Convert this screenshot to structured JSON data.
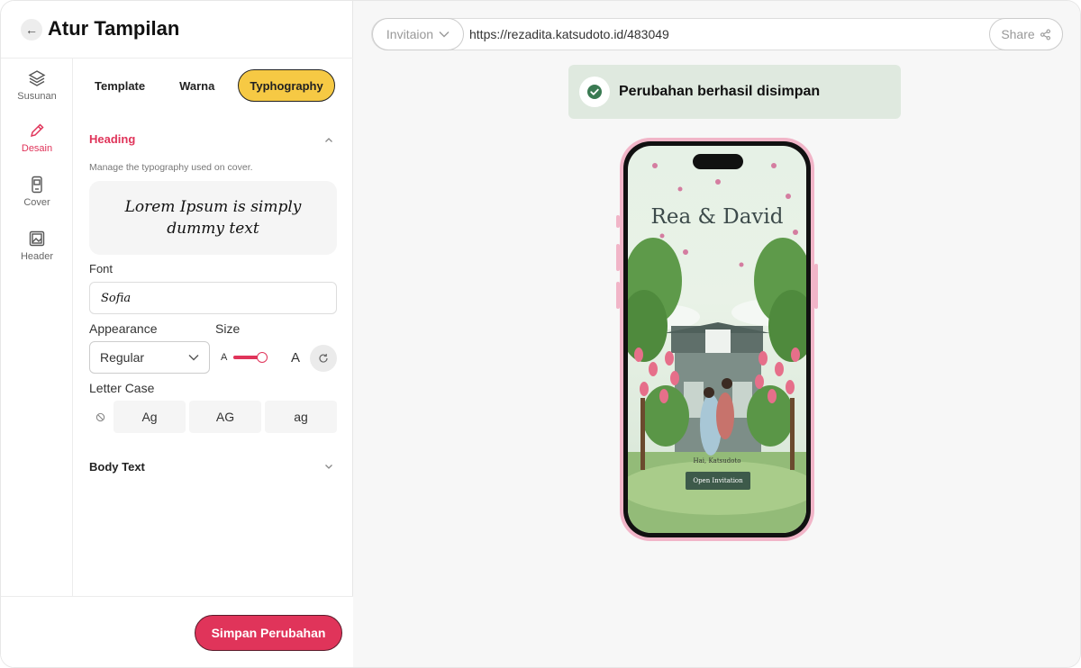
{
  "header": {
    "title": "Atur Tampilan"
  },
  "rail": [
    {
      "label": "Susunan",
      "icon": "layers-icon",
      "active": false
    },
    {
      "label": "Desain",
      "icon": "pen-icon",
      "active": true
    },
    {
      "label": "Cover",
      "icon": "phone-cover-icon",
      "active": false
    },
    {
      "label": "Header",
      "icon": "image-icon",
      "active": false
    }
  ],
  "tabs": [
    "Template",
    "Warna",
    "Typhography"
  ],
  "active_tab": "Typhography",
  "heading": {
    "title": "Heading",
    "description": "Manage the typography used on cover.",
    "preview_text": "Lorem Ipsum is simply dummy text",
    "font_label": "Font",
    "font_value": "Sofia",
    "appearance_label": "Appearance",
    "appearance_value": "Regular",
    "size_label": "Size",
    "size_small": "A",
    "size_big": "A",
    "size_level": 0.85,
    "letter_case_label": "Letter Case",
    "letter_case_options": [
      "Ag",
      "AG",
      "ag"
    ]
  },
  "body_text": {
    "title": "Body Text"
  },
  "footer": {
    "save_label": "Simpan Perubahan"
  },
  "browser": {
    "select_label": "Invitaion",
    "url": "https://rezadita.katsudoto.id/483049",
    "share_label": "Share"
  },
  "toast": {
    "message": "Perubahan berhasil disimpan"
  },
  "phone": {
    "couple": "Rea & David",
    "greeting": "Hai, Katsudoto",
    "open_label": "Open Invitation"
  },
  "colors": {
    "accent": "#e0345a",
    "tab_active": "#f6c944",
    "toast_bg": "#dfe9df",
    "success": "#3a7a52"
  }
}
